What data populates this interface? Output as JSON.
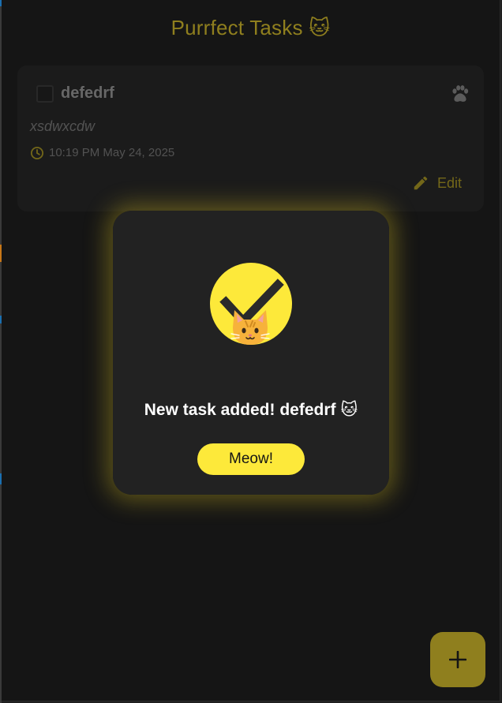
{
  "app": {
    "title": "Purrfect Tasks 🐱"
  },
  "task": {
    "title": "defedrf",
    "description": "xsdwxcdw",
    "timestamp": "10:19 PM May 24, 2025",
    "edit_label": "Edit",
    "completed": false
  },
  "dialog": {
    "message": "New task added! defedrf 🐱",
    "button_label": "Meow!"
  },
  "icons": {
    "paw": "paw-icon",
    "clock": "clock-icon",
    "edit": "pencil-icon",
    "success": "check-icon",
    "cat": "cat-face-icon",
    "add": "plus-icon"
  },
  "colors": {
    "accent": "#fde93a",
    "accent_dim": "#8f7f1e",
    "background": "#151515",
    "card": "#1c1c1c",
    "dialog": "#222222"
  }
}
